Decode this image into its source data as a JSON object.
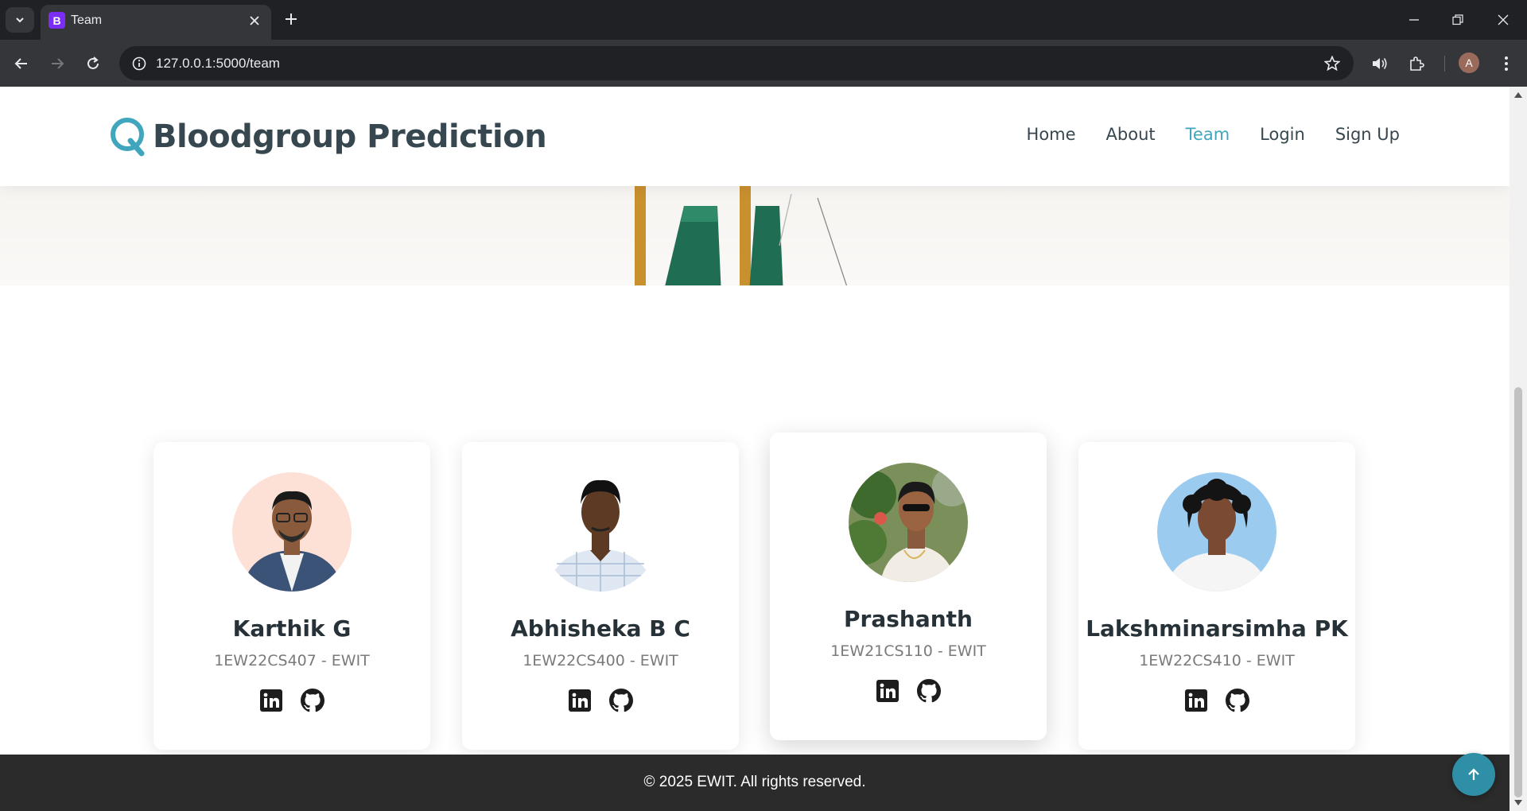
{
  "browser": {
    "tab_title": "Team",
    "tab_favicon_letter": "B",
    "url": "127.0.0.1:5000/team",
    "profile_initial": "A"
  },
  "site": {
    "brand": "Bloodgroup Prediction",
    "nav": [
      {
        "label": "Home",
        "active": false
      },
      {
        "label": "About",
        "active": false
      },
      {
        "label": "Team",
        "active": true
      },
      {
        "label": "Login",
        "active": false
      },
      {
        "label": "Sign Up",
        "active": false
      }
    ],
    "accent_color": "#3fa6bd"
  },
  "team": [
    {
      "name": "Karthik G",
      "id": "1EW22CS407 - EWIT",
      "photo_bg": "#fde0d6",
      "highlighted": false
    },
    {
      "name": "Abhisheka B C",
      "id": "1EW22CS400 - EWIT",
      "photo_bg": "#ffffff",
      "highlighted": false
    },
    {
      "name": "Prashanth",
      "id": "1EW21CS110 - EWIT",
      "photo_bg": "#7a8f5a",
      "highlighted": true
    },
    {
      "name": "Lakshminarsimha PK",
      "id": "1EW22CS410 - EWIT",
      "photo_bg": "#9ccbf0",
      "highlighted": false
    }
  ],
  "footer": {
    "text": "© 2025 EWIT. All rights reserved."
  }
}
